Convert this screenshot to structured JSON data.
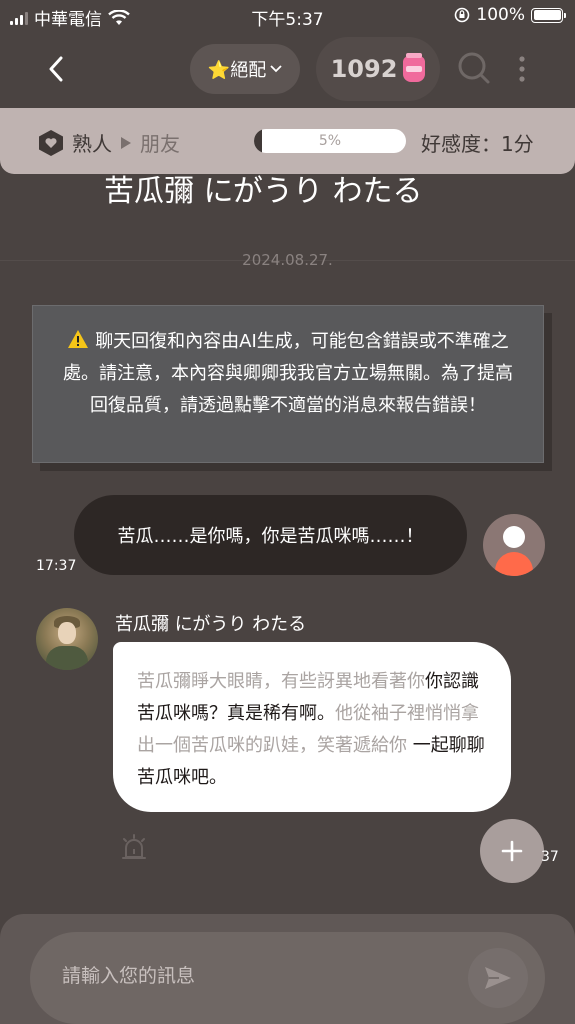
{
  "status_bar": {
    "carrier": "中華電信",
    "time": "下午5:37",
    "battery": "100%"
  },
  "header": {
    "match_label": "⭐絕配",
    "coins": "1092"
  },
  "affinity": {
    "current_stage": "熟人",
    "next_stage": "朋友",
    "progress_text": "5%",
    "progress": 0.05,
    "score": "好感度：1分"
  },
  "chat": {
    "title_partial": "苦瓜彌 にがうり わたる",
    "date": "2024.08.27.",
    "notice": "聊天回復和內容由AI生成，可能包含錯誤或不準確之處。請注意，本內容與卿卿我我官方立場無關。為了提高回復品質，請透過點擊不適當的消息來報告錯誤！",
    "messages": [
      {
        "sender": "user",
        "text": "苦瓜……是你嗎，你是苦瓜咪嗎……！",
        "time": "17:37"
      },
      {
        "sender": "bot",
        "name": "苦瓜彌 にがうり わたる",
        "segments": [
          {
            "text": "苦瓜彌睜大眼睛，有些訝異地看著你",
            "type": "narration"
          },
          {
            "text": "你認識苦瓜咪嗎？真是稀有啊。",
            "type": "dialog"
          },
          {
            "text": "他從袖子裡悄悄拿出一個苦瓜咪的趴娃，笑著遞給你",
            "type": "narration"
          },
          {
            "text": " 一起聊聊苦瓜咪吧。",
            "type": "dialog"
          }
        ],
        "time": "37"
      }
    ]
  },
  "input": {
    "placeholder": "請輸入您的訊息"
  },
  "colors": {
    "background": "#4a4341",
    "affinity_bar": "#bfb3b1",
    "user_bubble": "#2d2725",
    "bot_bubble": "#ffffff",
    "user_avatar_accent": "#ff6a4a"
  }
}
